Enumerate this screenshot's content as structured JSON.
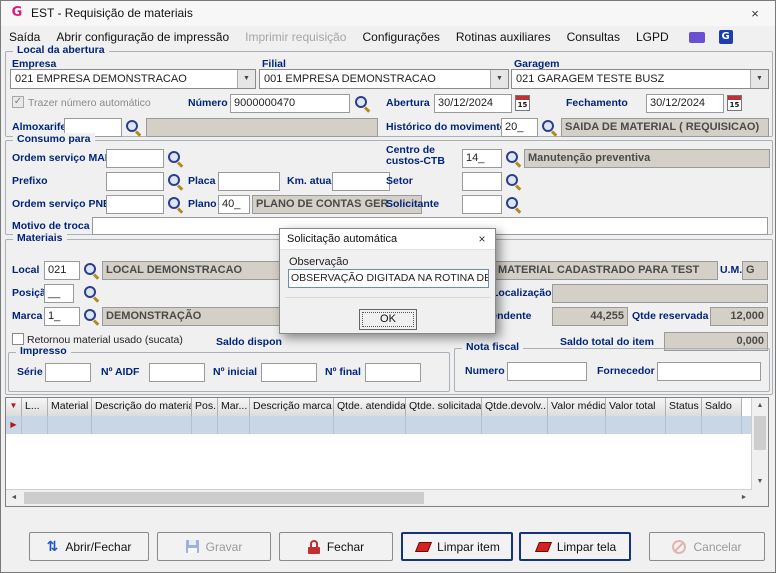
{
  "colors": {
    "label_navy": "#00247c",
    "readonly_bg": "#d4d0c8",
    "selected_row": "#c9d6e6",
    "marker_red": "#c01010",
    "default_button_border": "#16337a"
  },
  "icons": {
    "combo_arrow": "▼",
    "scroll_up": "▲",
    "scroll_down": "▼",
    "scroll_left": "◄",
    "scroll_right": "►",
    "check": "✓",
    "open_close_arrows": "⇅",
    "grid_marker_header": "▼",
    "grid_marker_row": "▶",
    "calendar_day": "15"
  },
  "window": {
    "title": "EST - Requisição de materiais",
    "app_icon_letter": "G",
    "close_glyph": "×"
  },
  "menu": {
    "saida": "Saída",
    "abrir_config": "Abrir configuração de impressão",
    "imprimir": "Imprimir requisição",
    "configuracoes": "Configurações",
    "rotinas": "Rotinas auxiliares",
    "consultas": "Consultas",
    "lgpd": "LGPD",
    "g_badge": "G"
  },
  "local_abertura": {
    "caption": "Local da abertura",
    "empresa_label": "Empresa",
    "empresa_value": "021 EMPRESA DEMONSTRACAO",
    "filial_label": "Filial",
    "filial_value": "001 EMPRESA DEMONSTRACAO",
    "garagem_label": "Garagem",
    "garagem_value": "021 GARAGEM TESTE BUSZ",
    "trazer_numero_label": "Trazer número automático",
    "numero_label": "Número",
    "numero_value": "9000000470",
    "abertura_label": "Abertura",
    "abertura_value": "30/12/2024",
    "fechamento_label": "Fechamento",
    "fechamento_value": "30/12/2024",
    "almoxarife_label": "Almoxarife",
    "almoxarife_code": "",
    "almoxarife_desc": "",
    "historico_label": "Histórico do movimento",
    "historico_code": "20_",
    "historico_desc": "SAIDA DE MATERIAL ( REQUISICAO)"
  },
  "consumo": {
    "caption": "Consumo para",
    "os_man_label": "Ordem serviço MAN",
    "os_man_value": "",
    "centro_custos_label": "Centro de custos-CTB",
    "centro_custos_code": "14_",
    "centro_custos_desc": "Manutenção preventiva",
    "prefixo_label": "Prefixo",
    "prefixo_value": "",
    "placa_label": "Placa",
    "placa_value": "",
    "km_label": "Km. atual",
    "km_value": "",
    "setor_label": "Setor",
    "setor_value": "",
    "os_pne_label": "Ordem serviço PNE",
    "os_pne_value": "",
    "plano_label": "Plano",
    "plano_code": "40_",
    "plano_desc": "PLANO DE CONTAS GER",
    "solicitante_label": "Solicitante",
    "solicitante_value": "",
    "motivo_label": "Motivo de troca",
    "motivo_value": ""
  },
  "materiais": {
    "caption": "Materiais",
    "local_label": "Local",
    "local_code": "021",
    "local_desc": "LOCAL DEMONSTRACAO",
    "material_desc": "MATERIAL CADASTRADO PARA TEST",
    "um_label": "U.M.",
    "um_value": "G",
    "posicao_label": "Posição",
    "posicao_value": "__",
    "localizacao_label": "Localização",
    "localizacao_value": "",
    "marca_label": "Marca",
    "marca_code": "1_",
    "marca_desc": "DEMONSTRAÇÃO",
    "sucata_label": "Retornou material usado (sucata)",
    "saldo_disponivel_label": "Saldo disponível",
    "qtde_pendente_label": "Qtde pendente",
    "qtde_pendente_value": "44,255",
    "qtde_reservada_label": "Qtde reservada",
    "qtde_reservada_value": "12,000",
    "saldo_total_label": "Saldo total do item",
    "saldo_total_value": "0,000"
  },
  "impresso": {
    "caption": "Impresso",
    "serie_label": "Série",
    "serie_value": "",
    "aidf_label": "Nº AIDF",
    "aidf_value": "",
    "inicial_label": "Nº inicial",
    "inicial_value": "",
    "final_label": "Nº final",
    "final_value": ""
  },
  "nota_fiscal": {
    "caption": "Nota fiscal",
    "numero_label": "Numero",
    "numero_value": "",
    "fornecedor_label": "Fornecedor",
    "fornecedor_value": ""
  },
  "grid": {
    "columns": [
      "L...",
      "Material",
      "Descrição do material",
      "Pos.",
      "Mar...",
      "Descrição marca",
      "Qtde. atendida",
      "Qtde. solicitada",
      "Qtde.devolv...",
      "Valor médio",
      "Valor total",
      "Status",
      "Saldo"
    ]
  },
  "dialog": {
    "title": "Solicitação automática",
    "close_glyph": "×",
    "observacao_label": "Observação",
    "observacao_value": "OBSERVAÇÃO DIGITADA NA ROTINA DE ",
    "ok_label": "OK"
  },
  "footer": {
    "abrir_fechar": "Abrir/Fechar",
    "gravar": "Gravar",
    "fechar": "Fechar",
    "limpar_item": "Limpar item",
    "limpar_tela": "Limpar tela",
    "cancelar": "Cancelar"
  }
}
